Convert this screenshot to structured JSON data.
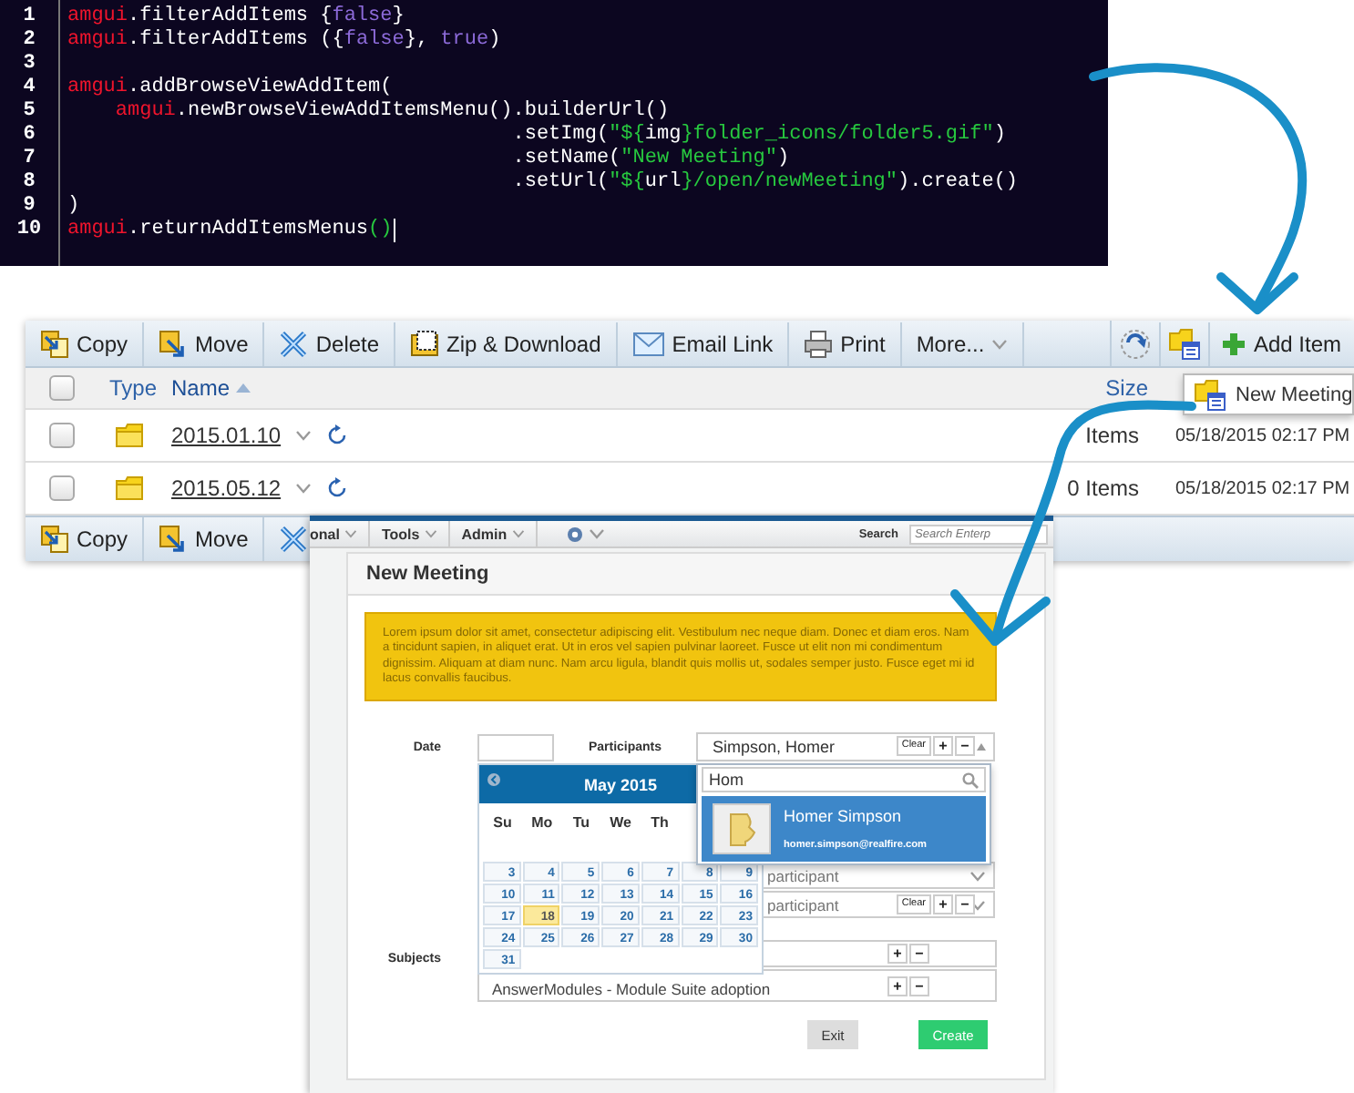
{
  "code_editor": {
    "lines": [
      {
        "number": "1",
        "cursor": false,
        "tokens": [
          {
            "kind": "object",
            "text": "amgui"
          },
          {
            "kind": "plain",
            "text": ".filterAddItems {"
          },
          {
            "kind": "keyword",
            "text": "false"
          },
          {
            "kind": "plain",
            "text": "}"
          }
        ]
      },
      {
        "number": "2",
        "cursor": false,
        "tokens": [
          {
            "kind": "object",
            "text": "amgui"
          },
          {
            "kind": "plain",
            "text": ".filterAddItems ({"
          },
          {
            "kind": "keyword",
            "text": "false"
          },
          {
            "kind": "plain",
            "text": "}, "
          },
          {
            "kind": "keyword",
            "text": "true"
          },
          {
            "kind": "plain",
            "text": ")"
          }
        ]
      },
      {
        "number": "3",
        "cursor": false
      },
      {
        "number": "4",
        "cursor": false,
        "tokens": [
          {
            "kind": "object",
            "text": "amgui"
          },
          {
            "kind": "plain",
            "text": ".addBrowseViewAddItem("
          }
        ]
      },
      {
        "number": "5",
        "cursor": false,
        "tokens": [
          {
            "kind": "object",
            "text": "    amgui"
          },
          {
            "kind": "plain",
            "text": ".newBrowseViewAddItemsMenu().builderUrl()"
          }
        ]
      },
      {
        "number": "6",
        "cursor": false,
        "tokens": [
          {
            "kind": "plain",
            "text": "                                     .setImg("
          },
          {
            "kind": "string",
            "text": "\"${"
          },
          {
            "kind": "plain",
            "text": "img"
          },
          {
            "kind": "string",
            "text": "}folder_icons/folder5.gif\""
          },
          {
            "kind": "plain",
            "text": ")"
          }
        ]
      },
      {
        "number": "7",
        "cursor": false,
        "tokens": [
          {
            "kind": "plain",
            "text": "                                     .setName("
          },
          {
            "kind": "string",
            "text": "\"New Meeting\""
          },
          {
            "kind": "plain",
            "text": ")"
          }
        ]
      },
      {
        "number": "8",
        "cursor": false,
        "tokens": [
          {
            "kind": "plain",
            "text": "                                     .setUrl("
          },
          {
            "kind": "string",
            "text": "\"${"
          },
          {
            "kind": "plain",
            "text": "url"
          },
          {
            "kind": "string",
            "text": "}/open/newMeeting\""
          },
          {
            "kind": "plain",
            "text": ").create()"
          }
        ]
      },
      {
        "number": "9",
        "cursor": false,
        "tokens": [
          {
            "kind": "plain",
            "text": ")"
          }
        ]
      },
      {
        "number": "10",
        "cursor": true,
        "tokens": [
          {
            "kind": "object",
            "text": "amgui"
          },
          {
            "kind": "plain",
            "text": ".returnAddItemsMenus"
          },
          {
            "kind": "string",
            "text": "()"
          }
        ]
      }
    ]
  },
  "browser": {
    "toolbar": [
      {
        "kind": "copy",
        "label": "Copy"
      },
      {
        "kind": "move",
        "label": "Move"
      },
      {
        "kind": "delete",
        "label": "Delete"
      },
      {
        "kind": "zip",
        "label": "Zip & Download"
      },
      {
        "kind": "email",
        "label": "Email Link"
      },
      {
        "kind": "print",
        "label": "Print"
      },
      {
        "kind": "more",
        "label": "More..."
      }
    ],
    "add_item": {
      "label": "Add Item"
    },
    "add_menu": [
      {
        "label": "New Meeting"
      }
    ],
    "select_all": {
      "checked": false
    },
    "columns": [
      {
        "label": "Type",
        "sorted": false
      },
      {
        "label": "Name",
        "sorted": true
      },
      {
        "label": "Size",
        "sorted": false
      }
    ],
    "rows": [
      {
        "checked": false,
        "name": "2015.01.10",
        "size": "Items",
        "modified": "05/18/2015 02:17 PM"
      },
      {
        "checked": false,
        "name": "2015.05.12",
        "size": "0 Items",
        "modified": "05/18/2015 02:17 PM"
      }
    ],
    "bottom_toolbar": [
      {
        "kind": "copy",
        "label": "Copy"
      },
      {
        "kind": "move",
        "label": "Move"
      },
      {
        "kind": "delete"
      }
    ]
  },
  "form": {
    "nav": [
      {
        "label": "onal"
      },
      {
        "label": "Tools"
      },
      {
        "label": "Admin"
      }
    ],
    "search": {
      "label": "Search",
      "placeholder": "Search Enterp"
    },
    "title": "New Meeting",
    "notice": "Lorem ipsum dolor sit amet, consectetur adipiscing elit. Vestibulum nec neque diam. Donec et diam eros. Nam a tincidunt sapien, in aliquet erat. Ut in eros vel sapien pulvinar laoreet. Fusce ut elit non mi condimentum dignissim. Aliquam at diam nunc. Nam arcu ligula, blandit quis mollis ut, sodales semper justo. Fusce eget mi id lacus convallis faucibus.",
    "date_label": "Date",
    "participants": {
      "label": "Participants",
      "value": "Simpson, Homer",
      "buttons": [
        "Clear",
        "+",
        "−"
      ],
      "query": "Hom",
      "result": {
        "name": "Homer Simpson",
        "email": "homer.simpson@realfire.com"
      },
      "more_fields": [
        {
          "placeholder": "participant"
        },
        {
          "placeholder": "participant",
          "buttons": [
            "Clear",
            "+",
            "−"
          ]
        }
      ]
    },
    "calendar": {
      "title": "May 2015",
      "weekdays": [
        "Su",
        "Mo",
        "Tu",
        "We",
        "Th"
      ],
      "weeks": [
        [
          {
            "day": "3",
            "selected": false
          },
          {
            "day": "4",
            "selected": false
          },
          {
            "day": "5",
            "selected": false
          },
          {
            "day": "6",
            "selected": false
          },
          {
            "day": "7",
            "selected": false
          },
          {
            "day": "8",
            "selected": false
          },
          {
            "day": "9",
            "selected": false
          }
        ],
        [
          {
            "day": "10",
            "selected": false
          },
          {
            "day": "11",
            "selected": false
          },
          {
            "day": "12",
            "selected": false
          },
          {
            "day": "13",
            "selected": false
          },
          {
            "day": "14",
            "selected": false
          },
          {
            "day": "15",
            "selected": false
          },
          {
            "day": "16",
            "selected": false
          }
        ],
        [
          {
            "day": "17",
            "selected": false
          },
          {
            "day": "18",
            "selected": true
          },
          {
            "day": "19",
            "selected": false
          },
          {
            "day": "20",
            "selected": false
          },
          {
            "day": "21",
            "selected": false
          },
          {
            "day": "22",
            "selected": false
          },
          {
            "day": "23",
            "selected": false
          }
        ],
        [
          {
            "day": "24",
            "selected": false
          },
          {
            "day": "25",
            "selected": false
          },
          {
            "day": "26",
            "selected": false
          },
          {
            "day": "27",
            "selected": false
          },
          {
            "day": "28",
            "selected": false
          },
          {
            "day": "29",
            "selected": false
          },
          {
            "day": "30",
            "selected": false
          }
        ],
        [
          {
            "day": "31",
            "selected": false
          }
        ]
      ]
    },
    "subjects": {
      "label": "Subjects",
      "fields": [
        {
          "buttons": [
            "+",
            "−"
          ]
        },
        {
          "value": "AnswerModules - Module Suite adoption",
          "buttons": [
            "+",
            "−"
          ]
        }
      ]
    },
    "actions": [
      {
        "kind": "secondary",
        "label": "Exit"
      },
      {
        "kind": "primary",
        "label": "Create"
      }
    ]
  }
}
